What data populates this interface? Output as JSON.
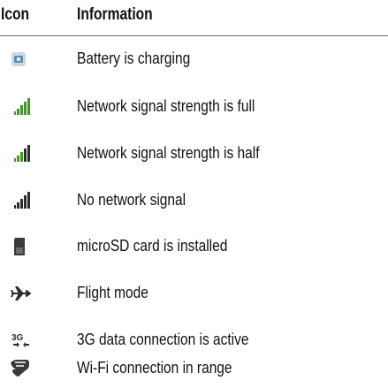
{
  "table": {
    "header": {
      "icon_col": "Icon",
      "info_col": "Information"
    },
    "rows": [
      {
        "icon": "battery-charging-icon",
        "text": "Battery is charging"
      },
      {
        "icon": "signal-full-icon",
        "text": "Network signal strength is full"
      },
      {
        "icon": "signal-half-icon",
        "text": "Network signal strength is half"
      },
      {
        "icon": "no-signal-icon",
        "text": "No network signal"
      },
      {
        "icon": "microsd-card-icon",
        "text": "microSD card is installed"
      },
      {
        "icon": "airplane-icon",
        "text": "Flight mode"
      },
      {
        "icon": "3g-data-icon",
        "text": "3G data connection is active",
        "icon_label": "3G"
      },
      {
        "icon": "wifi-icon",
        "text": "Wi-Fi connection in range"
      }
    ]
  },
  "colors": {
    "signal_green": "#3f9a2a",
    "icon_dark": "#2d2d2d",
    "battery_blue": "#5c8fb0",
    "rule": "#6e6e6e"
  }
}
